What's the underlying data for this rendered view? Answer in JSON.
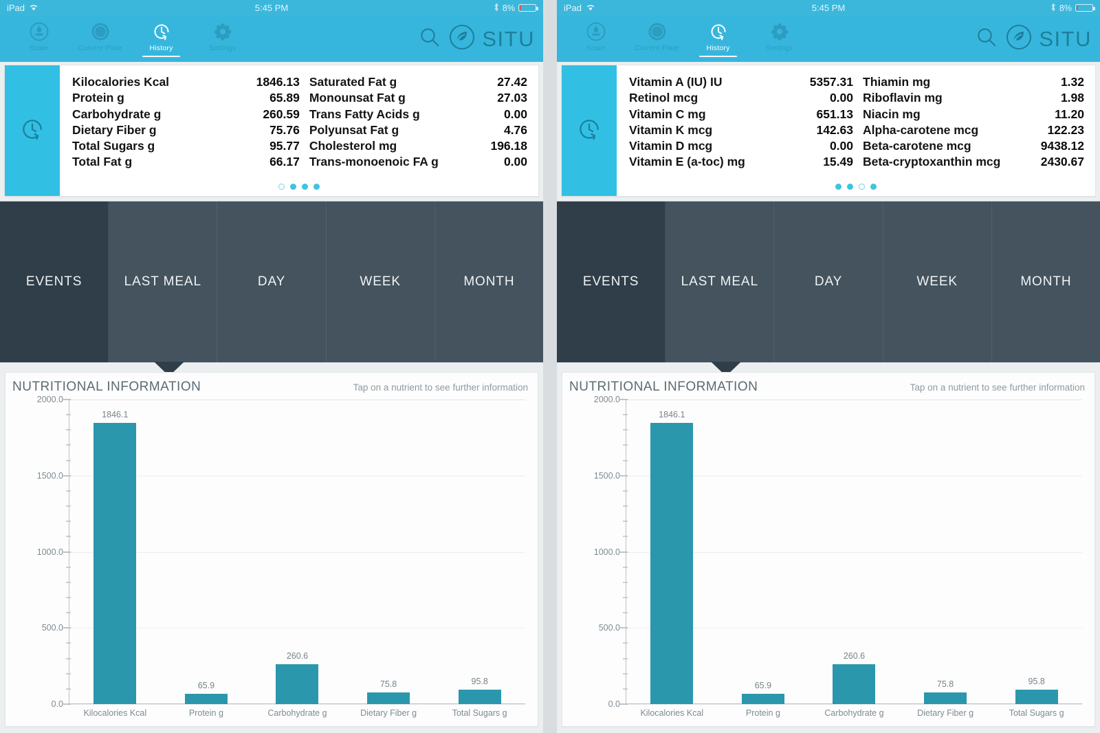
{
  "status_bar": {
    "device": "iPad",
    "wifi_icon": "wifi-icon",
    "time": "5:45 PM",
    "bluetooth_icon": "bluetooth-icon",
    "battery_percent": "8%",
    "battery_icon": "battery-low-icon"
  },
  "nav": {
    "items": [
      {
        "label": "Scale",
        "icon": "scale-icon",
        "active": false
      },
      {
        "label": "Current Plate",
        "icon": "plate-icon",
        "active": false
      },
      {
        "label": "History",
        "icon": "history-clock-icon",
        "active": true
      },
      {
        "label": "Settings",
        "icon": "gear-icon",
        "active": false
      }
    ],
    "search_icon": "search-icon",
    "logo_icon": "situ-leaf-logo-icon",
    "brand": "SITU"
  },
  "colors": {
    "header_cyan": "#37b6dd",
    "card_side_cyan": "#31c0e4",
    "bar_teal": "#2a97ad",
    "tab_bg": "#44535e",
    "tab_selected": "#2f3e49",
    "battery_low_red": "#e8513c"
  },
  "left_screen": {
    "card": {
      "side_icon": "history-clock-icon",
      "rows": [
        {
          "name": "Kilocalories Kcal",
          "value": "1846.13",
          "name2": "Saturated Fat g",
          "value2": "27.42"
        },
        {
          "name": "Protein g",
          "value": "65.89",
          "name2": "Monounsat Fat g",
          "value2": "27.03"
        },
        {
          "name": "Carbohydrate g",
          "value": "260.59",
          "name2": "Trans Fatty Acids g",
          "value2": "0.00"
        },
        {
          "name": "Dietary Fiber g",
          "value": "75.76",
          "name2": "Polyunsat Fat g",
          "value2": "4.76"
        },
        {
          "name": "Total Sugars g",
          "value": "95.77",
          "name2": "Cholesterol mg",
          "value2": "196.18"
        },
        {
          "name": "Total Fat g",
          "value": "66.17",
          "name2": "Trans-monoenoic FA g",
          "value2": "0.00"
        }
      ],
      "page_dots": [
        "hollow",
        "filled",
        "filled",
        "filled"
      ]
    },
    "tabs": [
      {
        "label": "EVENTS",
        "selected": true
      },
      {
        "label": "LAST MEAL",
        "selected": false
      },
      {
        "label": "DAY",
        "selected": false
      },
      {
        "label": "WEEK",
        "selected": false
      },
      {
        "label": "MONTH",
        "selected": false
      }
    ],
    "chart_panel": {
      "title": "NUTRITIONAL INFORMATION",
      "hint": "Tap on a nutrient to see further information"
    }
  },
  "right_screen": {
    "card": {
      "side_icon": "history-clock-icon",
      "rows": [
        {
          "name": "Vitamin A (IU) IU",
          "value": "5357.31",
          "name2": "Thiamin mg",
          "value2": "1.32"
        },
        {
          "name": "Retinol mcg",
          "value": "0.00",
          "name2": "Riboflavin mg",
          "value2": "1.98"
        },
        {
          "name": "Vitamin C mg",
          "value": "651.13",
          "name2": "Niacin mg",
          "value2": "11.20"
        },
        {
          "name": "Vitamin K mcg",
          "value": "142.63",
          "name2": "Alpha-carotene mcg",
          "value2": "122.23"
        },
        {
          "name": "Vitamin D mcg",
          "value": "0.00",
          "name2": "Beta-carotene mcg",
          "value2": "9438.12"
        },
        {
          "name": "Vitamin E (a-toc) mg",
          "value": "15.49",
          "name2": "Beta-cryptoxanthin mcg",
          "value2": "2430.67"
        }
      ],
      "page_dots": [
        "filled",
        "filled",
        "hollow",
        "filled"
      ]
    },
    "tabs": [
      {
        "label": "EVENTS",
        "selected": true
      },
      {
        "label": "LAST MEAL",
        "selected": false
      },
      {
        "label": "DAY",
        "selected": false
      },
      {
        "label": "WEEK",
        "selected": false
      },
      {
        "label": "MONTH",
        "selected": false
      }
    ],
    "chart_panel": {
      "title": "NUTRITIONAL INFORMATION",
      "hint": "Tap on a nutrient to see further information"
    }
  },
  "chart_data": [
    {
      "type": "bar",
      "title": "NUTRITIONAL INFORMATION",
      "categories": [
        "Kilocalories Kcal",
        "Protein g",
        "Carbohydrate g",
        "Dietary Fiber g",
        "Total Sugars g"
      ],
      "values": [
        1846.1,
        65.9,
        260.6,
        75.8,
        95.8
      ],
      "data_labels": [
        "1846.1",
        "65.9",
        "260.6",
        "75.8",
        "95.8"
      ],
      "xlabel": "",
      "ylabel": "",
      "ylim": [
        0,
        2000
      ],
      "yticks": [
        0,
        500,
        1000,
        1500,
        2000
      ],
      "ytick_labels": [
        "0.0",
        "500.0",
        "1000.0",
        "1500.0",
        "2000.0"
      ],
      "minor_tick_interval": 100,
      "grid": true,
      "legend": false,
      "bar_color": "#2a97ad"
    },
    {
      "type": "bar",
      "title": "NUTRITIONAL INFORMATION",
      "categories": [
        "Kilocalories Kcal",
        "Protein g",
        "Carbohydrate g",
        "Dietary Fiber g",
        "Total Sugars g"
      ],
      "values": [
        1846.1,
        65.9,
        260.6,
        75.8,
        95.8
      ],
      "data_labels": [
        "1846.1",
        "65.9",
        "260.6",
        "75.8",
        "95.8"
      ],
      "xlabel": "",
      "ylabel": "",
      "ylim": [
        0,
        2000
      ],
      "yticks": [
        0,
        500,
        1000,
        1500,
        2000
      ],
      "ytick_labels": [
        "0.0",
        "500.0",
        "1000.0",
        "1500.0",
        "2000.0"
      ],
      "minor_tick_interval": 100,
      "grid": true,
      "legend": false,
      "bar_color": "#2a97ad"
    }
  ]
}
